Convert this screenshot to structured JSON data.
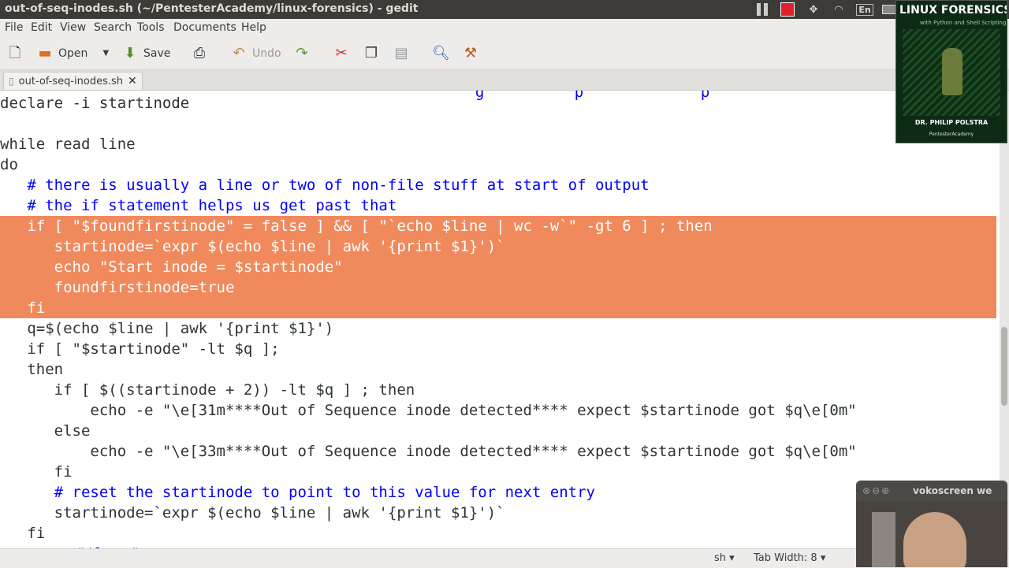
{
  "window": {
    "title": "out-of-seq-inodes.sh (~/PentesterAcademy/linux-forensics) - gedit"
  },
  "tray": {
    "lang": "En"
  },
  "menu": [
    "File",
    "Edit",
    "View",
    "Search",
    "Tools",
    "Documents",
    "Help"
  ],
  "toolbar": {
    "open": "Open",
    "save": "Save",
    "undo": "Undo"
  },
  "tab": {
    "label": "out-of-seq-inodes.sh",
    "close": "✕"
  },
  "code": [
    "declare -i startinode",
    "",
    "while read line",
    "do",
    "   # there is usually a line or two of non-file stuff at start of output",
    "   # the if statement helps us get past that",
    "   if [ \"$foundfirstinode\" = false ] && [ \"`echo $line | wc -w`\" -gt 6 ] ; then",
    "      startinode=`expr $(echo $line | awk '{print $1}')`",
    "      echo \"Start inode = $startinode\"",
    "      foundfirstinode=true",
    "   fi",
    "   q=$(echo $line | awk '{print $1}')",
    "   if [ \"$startinode\" -lt $q ];",
    "   then",
    "      if [ $((startinode + 2)) -lt $q ] ; then",
    "          echo -e \"\\e[31m****Out of Sequence inode detected**** expect $startinode got $q\\e[0m\"",
    "      else",
    "          echo -e \"\\e[33m****Out of Sequence inode detected**** expect $startinode got $q\\e[0m\"",
    "      fi",
    "      # reset the startinode to point to this value for next entry",
    "      startinode=`expr $(echo $line | awk '{print $1}')`",
    "   fi"
  ],
  "status": {
    "lang": "sh ▾",
    "tab_width": "Tab Width: 8 ▾"
  },
  "cover": {
    "title": "LINUX FORENSICS",
    "subtitle": "with Python and Shell Scripting",
    "author": "DR. PHILIP POLSTRA",
    "publisher": "PentesterAcademy"
  },
  "webcam": {
    "title": "vokoscreen we"
  }
}
